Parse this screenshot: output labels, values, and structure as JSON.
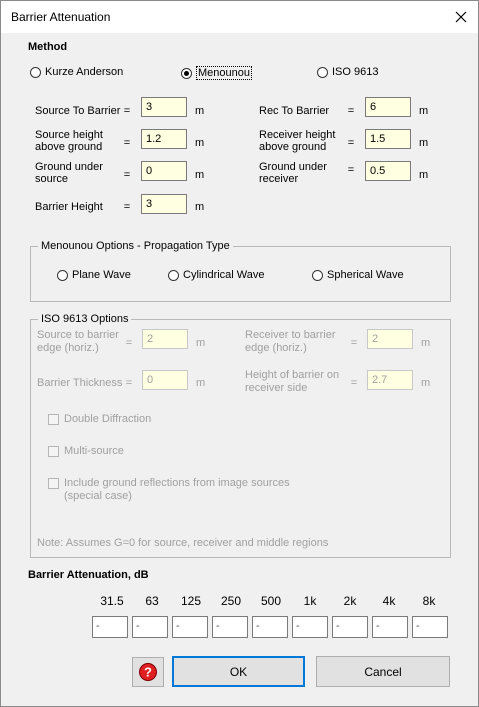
{
  "window": {
    "title": "Barrier Attenuation"
  },
  "method": {
    "label": "Method",
    "options": [
      {
        "label": "Kurze Anderson",
        "selected": false
      },
      {
        "label": "Menounou",
        "selected": true
      },
      {
        "label": "ISO 9613",
        "selected": false
      }
    ]
  },
  "geometry": {
    "source_to_barrier": {
      "label": "Source To Barrier",
      "value": "3",
      "unit": "m"
    },
    "rec_to_barrier": {
      "label": "Rec To Barrier",
      "value": "6",
      "unit": "m"
    },
    "source_height": {
      "label_line1": "Source height",
      "label_line2": "above ground",
      "value": "1.2",
      "unit": "m"
    },
    "receiver_height": {
      "label_line1": "Receiver height",
      "label_line2": "above ground",
      "value": "1.5",
      "unit": "m"
    },
    "ground_source": {
      "label_line1": "Ground under",
      "label_line2": "source",
      "value": "0",
      "unit": "m"
    },
    "ground_receiver": {
      "label_line1": "Ground under",
      "label_line2": "receiver",
      "value": "0.5",
      "unit": "m"
    },
    "barrier_height": {
      "label": "Barrier Height",
      "value": "3",
      "unit": "m"
    },
    "eq": "="
  },
  "menounou_options": {
    "title": "Menounou Options - Propagation Type",
    "options": [
      {
        "label": "Plane Wave",
        "selected": false
      },
      {
        "label": "Cylindrical Wave",
        "selected": false
      },
      {
        "label": "Spherical Wave",
        "selected": false
      }
    ]
  },
  "iso_options": {
    "title": "ISO 9613 Options",
    "source_edge": {
      "label_line1": "Source to barrier",
      "label_line2": "edge (horiz.)",
      "value": "2",
      "unit": "m"
    },
    "receiver_edge": {
      "label_line1": "Receiver to barrier",
      "label_line2": "edge (horiz.)",
      "value": "2",
      "unit": "m"
    },
    "barrier_thickness": {
      "label": "Barrier Thickness",
      "value": "0",
      "unit": "m"
    },
    "barrier_height_receiver": {
      "label_line1": "Height of barrier on",
      "label_line2": "receiver side",
      "value": "2.7",
      "unit": "m"
    },
    "double_diffraction": "Double Diffraction",
    "multi_source": "Multi-source",
    "ground_reflections_line1": "Include ground reflections from image sources",
    "ground_reflections_line2": "(special case)",
    "note": "Note: Assumes G=0 for source, receiver and middle regions"
  },
  "attenuation": {
    "title": "Barrier Attenuation, dB",
    "frequencies": [
      "31.5",
      "63",
      "125",
      "250",
      "500",
      "1k",
      "2k",
      "4k",
      "8k"
    ],
    "values": [
      "-",
      "-",
      "-",
      "-",
      "-",
      "-",
      "-",
      "-",
      "-"
    ]
  },
  "buttons": {
    "ok": "OK",
    "cancel": "Cancel"
  },
  "colors": {
    "input_bg": "#ffffe1",
    "dialog_bg": "#f0f0f0",
    "focus_border": "#0078d7"
  }
}
